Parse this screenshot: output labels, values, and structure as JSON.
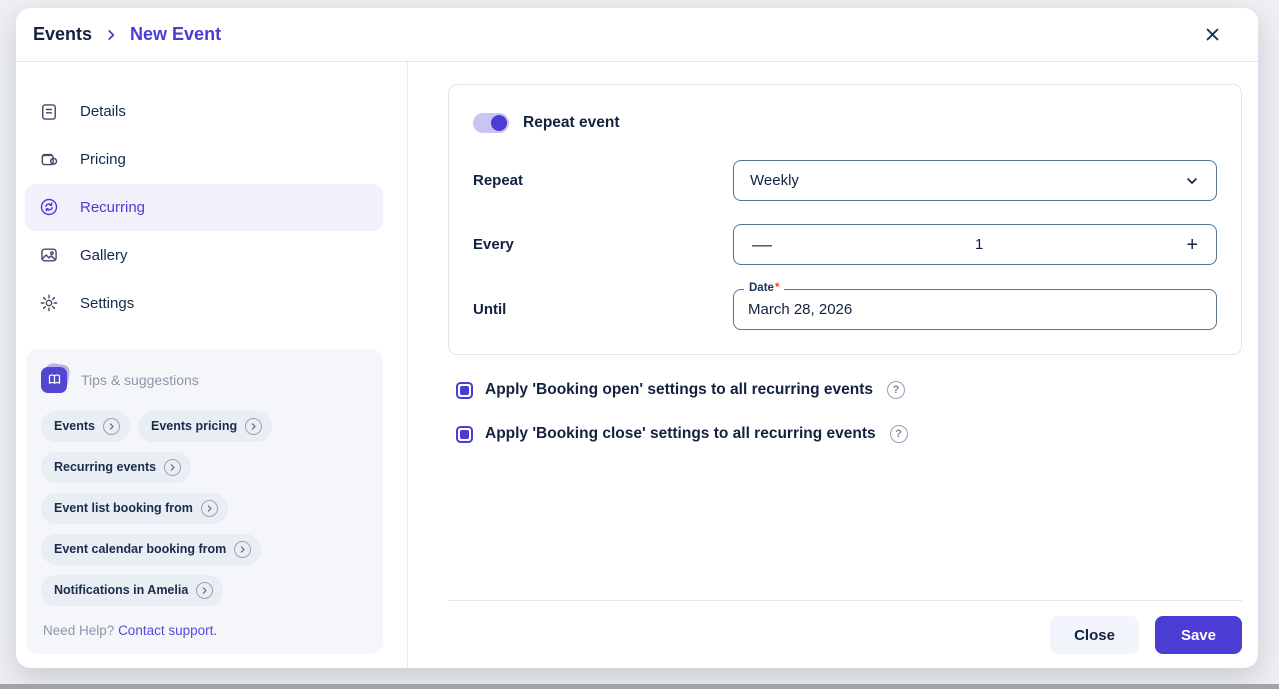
{
  "colors": {
    "accent": "#4b3dd4",
    "accent_track": "#c9c4f1",
    "text_dark": "#13223f",
    "muted": "#8d96a8",
    "input_border": "#56748f",
    "required_red": "#e8452f"
  },
  "breadcrumb": {
    "root": "Events",
    "current": "New Event"
  },
  "sidebar": {
    "items": [
      {
        "label": "Details",
        "active": false
      },
      {
        "label": "Pricing",
        "active": false
      },
      {
        "label": "Recurring",
        "active": true
      },
      {
        "label": "Gallery",
        "active": false
      },
      {
        "label": "Settings",
        "active": false
      }
    ],
    "tips": {
      "title": "Tips & suggestions",
      "chips": [
        {
          "label": "Events"
        },
        {
          "label": "Events pricing"
        },
        {
          "label": "Recurring events"
        },
        {
          "label": "Event list booking from"
        },
        {
          "label": "Event calendar booking from"
        },
        {
          "label": "Notifications in Amelia"
        }
      ],
      "help_prefix": "Need Help?",
      "help_link": "Contact support."
    }
  },
  "form": {
    "toggle": {
      "label": "Repeat event",
      "on": true
    },
    "repeat": {
      "label": "Repeat",
      "value": "Weekly"
    },
    "every": {
      "label": "Every",
      "value": "1"
    },
    "until": {
      "label": "Until",
      "field_label": "Date",
      "required_mark": "*",
      "value": "March 28, 2026"
    },
    "checkboxes": [
      {
        "label": "Apply 'Booking open' settings to all recurring events",
        "checked": true
      },
      {
        "label": "Apply 'Booking close' settings to all recurring events",
        "checked": true
      }
    ]
  },
  "icons": {
    "minus": "—",
    "plus": "+",
    "help": "?"
  },
  "footer": {
    "close_label": "Close",
    "save_label": "Save"
  }
}
